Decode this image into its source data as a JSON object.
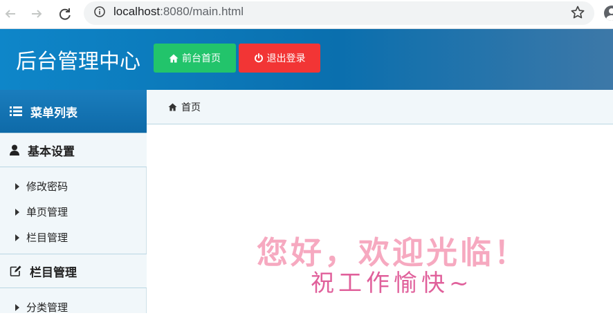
{
  "browser": {
    "url_host": "localhost",
    "url_rest": ":8080/main.html"
  },
  "header": {
    "title": "后台管理中心",
    "home_button": "前台首页",
    "logout_button": "退出登录",
    "colors": {
      "home": "#22c46b",
      "logout": "#f23535",
      "header": "#0e86c9"
    }
  },
  "sidebar": {
    "title": "菜单列表",
    "groups": [
      {
        "label": "基本设置",
        "icon": "user-icon",
        "items": [
          {
            "label": "修改密码"
          },
          {
            "label": "单页管理"
          },
          {
            "label": "栏目管理"
          }
        ]
      },
      {
        "label": "栏目管理",
        "icon": "edit-icon",
        "items": [
          {
            "label": "分类管理"
          }
        ]
      }
    ]
  },
  "breadcrumb": {
    "label": "首页"
  },
  "main": {
    "welcome": "您好，欢迎光临！",
    "wish": "祝工作愉快~"
  }
}
